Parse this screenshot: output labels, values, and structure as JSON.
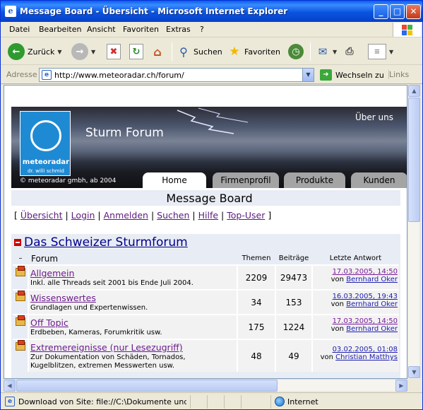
{
  "window": {
    "title": "Message Board - Übersicht - Microsoft Internet Explorer",
    "icon": "ie-page-icon",
    "controls": [
      "minimize",
      "maximize",
      "close"
    ]
  },
  "menubar": {
    "items": [
      "Datei",
      "Bearbeiten",
      "Ansicht",
      "Favoriten",
      "Extras",
      "?"
    ]
  },
  "toolbar": {
    "back": "Zurück",
    "search": "Suchen",
    "favorites": "Favoriten"
  },
  "address": {
    "label": "Adresse",
    "url": "http://www.meteoradar.ch/forum/",
    "go": "Wechseln zu",
    "links": "Links"
  },
  "status": {
    "text": "Download von Site: file://C:\\Dokumente und Einst",
    "zone": "Internet"
  },
  "banner": {
    "logo_brand": "meteoradar",
    "logo_sub": "dr. willi schmid",
    "title": "Sturm Forum",
    "about": "Über uns",
    "copyright": "© meteoradar gmbh, ab 2004",
    "tabs": [
      "Home",
      "Firmenprofil",
      "Produkte",
      "Kunden"
    ]
  },
  "board": {
    "title": "Message Board",
    "nav_open": "[",
    "nav_close": "]",
    "nav_sep": "|",
    "nav": [
      "Übersicht",
      "Login",
      "Anmelden",
      "Suchen",
      "Hilfe",
      "Top-User"
    ]
  },
  "category": {
    "name": "Das Schweizer Sturmforum",
    "collapse": "–",
    "headers": {
      "forum": "Forum",
      "topics": "Themen",
      "posts": "Beiträge",
      "last": "Letzte Antwort"
    },
    "by": "von",
    "rows": [
      {
        "name": "Allgemein",
        "desc": "Inkl. alle Threads seit 2001 bis Ende Juli 2004.",
        "topics": "2209",
        "posts": "29473",
        "date": "17.03.2005, 14:50",
        "user": "Bernhard Oker"
      },
      {
        "name": "Wissenswertes",
        "desc": "Grundlagen und Expertenwissen.",
        "topics": "34",
        "posts": "153",
        "date": "16.03.2005, 19:43",
        "user": "Bernhard Oker"
      },
      {
        "name": "Off Topic",
        "desc": "Erdbeben, Kameras, Forumkritik usw.",
        "topics": "175",
        "posts": "1224",
        "date": "17.03.2005, 14:50",
        "user": "Bernhard Oker"
      },
      {
        "name": "Extremereignisse (nur Lesezugriff)",
        "desc1": "Zur Dokumentation von Schäden, Tornados,",
        "desc2": "Kugelblitzen, extremen Messwerten usw.",
        "topics": "48",
        "posts": "49",
        "date": "03.02.2005, 01:08",
        "user": "Christian Matthys"
      }
    ]
  }
}
